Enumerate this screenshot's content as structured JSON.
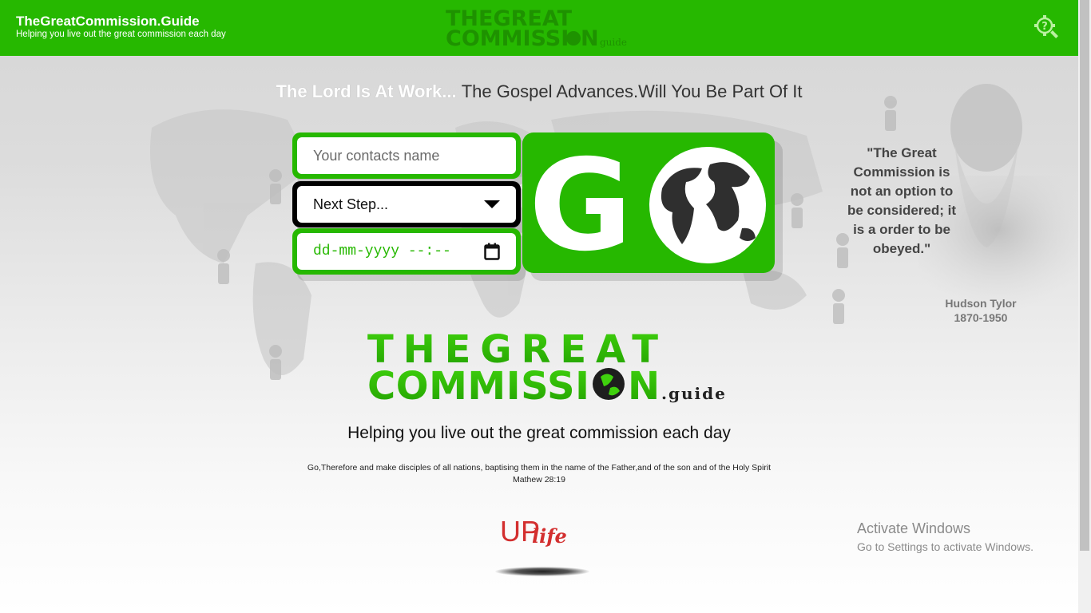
{
  "header": {
    "title": "TheGreatCommission.Guide",
    "subtitle": "Helping you live out the great commission each day",
    "logo_line1": "THEGREAT",
    "logo_line2": "COMMISSI",
    "logo_line2_end": "N",
    "logo_suffix": "guide",
    "help_icon": "help-gear-magnifier-icon"
  },
  "hero": {
    "tagline_part1": "The Lord Is At Work...",
    "tagline_part2": "The Gospel Advances.Will You Be Part Of It"
  },
  "form": {
    "contact_placeholder": "Your contacts name",
    "next_step_selected": "Next Step...",
    "date_placeholder": "dd-mm-yyyy --:--",
    "go_label": "G",
    "dropdown_icon": "caret-down-icon",
    "calendar_icon": "calendar-icon",
    "globe_icon": "globe-icon"
  },
  "quote": {
    "text": "\"The Great Commission is not an option to be considered; it is a order to be obeyed.\"",
    "author": "Hudson Tylor",
    "years": "1870-1950"
  },
  "main_logo": {
    "line1": "THEGREAT",
    "line2": "COMMISSI",
    "line2_end": "N",
    "suffix": ".guide"
  },
  "helping_text": "Helping you live out the great commission each day",
  "verse": {
    "text": "Go,Therefore and make disciples of all nations, baptising them in the name of the Father,and of the son and of the Holy Spirit",
    "reference": "Mathew 28:19"
  },
  "footer_logo": {
    "up": "UP",
    "life": "life"
  },
  "watermark": {
    "title": "Activate Windows",
    "subtitle": "Go to Settings to activate Windows."
  },
  "colors": {
    "brand_green": "#26b800",
    "dark_green": "#1a7a00"
  }
}
